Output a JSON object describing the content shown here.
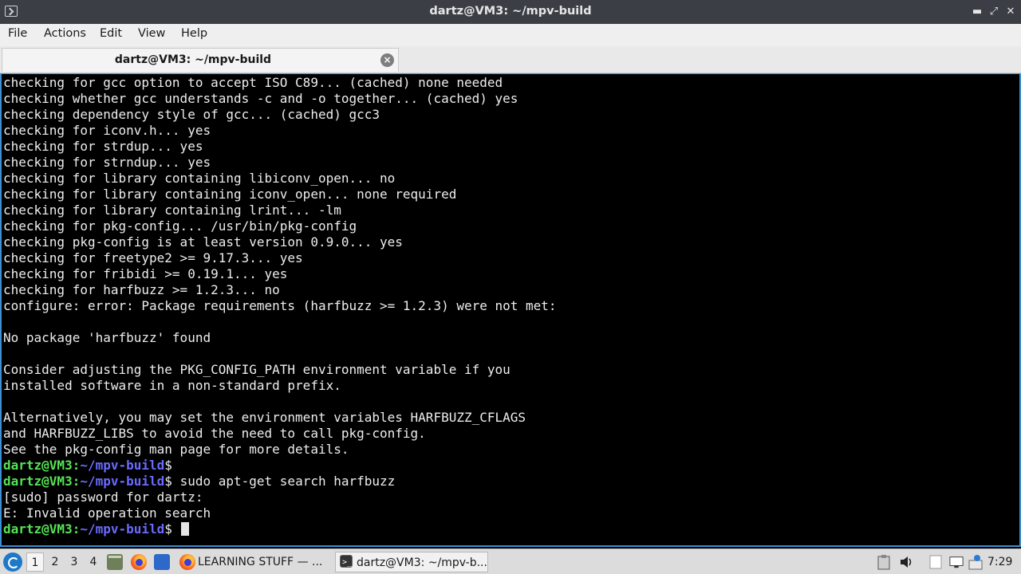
{
  "window": {
    "title": "dartz@VM3: ~/mpv-build",
    "controls": {
      "minimize": "▬",
      "maximize": "⤢",
      "close": "✕"
    }
  },
  "menu": [
    "File",
    "Actions",
    "Edit",
    "View",
    "Help"
  ],
  "tab": {
    "label": "dartz@VM3: ~/mpv-build",
    "close": "×"
  },
  "terminal": {
    "prompt_user": "dartz@VM3:",
    "prompt_path": "~/mpv-build",
    "lines": [
      {
        "text": "checking for gcc option to accept ISO C89... (cached) none needed"
      },
      {
        "text": "checking whether gcc understands -c and -o together... (cached) yes"
      },
      {
        "text": "checking dependency style of gcc... (cached) gcc3"
      },
      {
        "text": "checking for iconv.h... yes"
      },
      {
        "text": "checking for strdup... yes"
      },
      {
        "text": "checking for strndup... yes"
      },
      {
        "text": "checking for library containing libiconv_open... no"
      },
      {
        "text": "checking for library containing iconv_open... none required"
      },
      {
        "text": "checking for library containing lrint... -lm"
      },
      {
        "text": "checking for pkg-config... /usr/bin/pkg-config"
      },
      {
        "text": "checking pkg-config is at least version 0.9.0... yes"
      },
      {
        "text": "checking for freetype2 >= 9.17.3... yes"
      },
      {
        "text": "checking for fribidi >= 0.19.1... yes"
      },
      {
        "text": "checking for harfbuzz >= 1.2.3... no"
      },
      {
        "text": "configure: error: Package requirements (harfbuzz >= 1.2.3) were not met:"
      },
      {
        "text": ""
      },
      {
        "text": "No package 'harfbuzz' found"
      },
      {
        "text": ""
      },
      {
        "text": "Consider adjusting the PKG_CONFIG_PATH environment variable if you"
      },
      {
        "text": "installed software in a non-standard prefix."
      },
      {
        "text": ""
      },
      {
        "text": "Alternatively, you may set the environment variables HARFBUZZ_CFLAGS"
      },
      {
        "text": "and HARFBUZZ_LIBS to avoid the need to call pkg-config."
      },
      {
        "text": "See the pkg-config man page for more details."
      },
      {
        "prompt": true,
        "cmd": ""
      },
      {
        "prompt": true,
        "cmd": " sudo apt-get search harfbuzz"
      },
      {
        "text": "[sudo] password for dartz:"
      },
      {
        "text": "E: Invalid operation search"
      },
      {
        "prompt": true,
        "cmd": " ",
        "cursor": true
      }
    ],
    "prompt_symbol": "$"
  },
  "taskbar": {
    "workspaces": [
      "1",
      "2",
      "3",
      "4"
    ],
    "active_workspace": "1",
    "tasks": [
      {
        "label": "LEARNING STUFF — ...",
        "icon": "firefox-icon"
      },
      {
        "label": "dartz@VM3: ~/mpv-b...",
        "icon": "terminal-icon",
        "active": true
      }
    ],
    "clock": "7:29"
  }
}
